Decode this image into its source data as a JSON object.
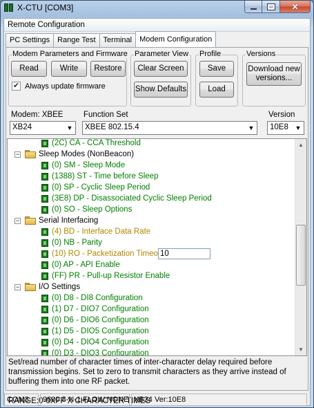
{
  "window": {
    "title": "X-CTU  [COM3]"
  },
  "header": {
    "title": "Remote Configuration"
  },
  "tabs": [
    {
      "label": "PC Settings"
    },
    {
      "label": "Range Test"
    },
    {
      "label": "Terminal"
    },
    {
      "label": "Modem Configuration",
      "active": true
    }
  ],
  "groups": {
    "modem_params": {
      "legend": "Modem Parameters and Firmware",
      "read": "Read",
      "write": "Write",
      "restore": "Restore",
      "always_update": "Always update firmware",
      "always_update_checked": true
    },
    "param_view": {
      "legend": "Parameter View",
      "clear": "Clear Screen",
      "show_defaults": "Show Defaults"
    },
    "profile": {
      "legend": "Profile",
      "save": "Save",
      "load": "Load"
    },
    "versions": {
      "legend": "Versions",
      "download_line1": "Download new",
      "download_line2": "versions..."
    }
  },
  "selectors": {
    "modem_label": "Modem: XBEE",
    "modem_value": "XB24",
    "function_label": "Function Set",
    "function_value": "XBEE 802.15.4",
    "version_label": "Version",
    "version_value": "10E8"
  },
  "tree": {
    "rows": [
      {
        "kind": "param",
        "text": "(2C) CA - CCA Threshold",
        "color": "green"
      },
      {
        "kind": "folder",
        "text": "Sleep Modes (NonBeacon)"
      },
      {
        "kind": "param",
        "text": "(0) SM - Sleep Mode",
        "color": "green"
      },
      {
        "kind": "param",
        "text": "(1388) ST - Time before Sleep",
        "color": "green"
      },
      {
        "kind": "param",
        "text": "(0) SP - Cyclic Sleep Period",
        "color": "green"
      },
      {
        "kind": "param",
        "text": "(3E8) DP - Disassociated Cyclic Sleep Period",
        "color": "green"
      },
      {
        "kind": "param",
        "text": "(0) SO - Sleep Options",
        "color": "green"
      },
      {
        "kind": "folder",
        "text": "Serial Interfacing"
      },
      {
        "kind": "param",
        "text": "(4) BD - Interface Data Rate",
        "color": "orange"
      },
      {
        "kind": "param",
        "text": "(0) NB - Parity",
        "color": "green"
      },
      {
        "kind": "param",
        "text": "(10) RO - Packetization Timeout",
        "color": "orange",
        "edit_value": "10"
      },
      {
        "kind": "param",
        "text": "(0) AP - API Enable",
        "color": "green"
      },
      {
        "kind": "param",
        "text": "(FF) PR - Pull-up Resistor Enable",
        "color": "green"
      },
      {
        "kind": "folder",
        "text": "I/O Settings"
      },
      {
        "kind": "param",
        "text": "(0) D8 - DI8 Configuration",
        "color": "green"
      },
      {
        "kind": "param",
        "text": "(1) D7 - DIO7 Configuration",
        "color": "green"
      },
      {
        "kind": "param",
        "text": "(0) D6 - DIO6 Configuration",
        "color": "green"
      },
      {
        "kind": "param",
        "text": "(1) D5 - DIO5 Configuration",
        "color": "green"
      },
      {
        "kind": "param",
        "text": "(0) D4 - DIO4 Configuration",
        "color": "green"
      },
      {
        "kind": "param",
        "text": "(0) D3 - DIO3 Configuration",
        "color": "green"
      }
    ]
  },
  "description": "Set/read number of character times of inter-character delay required before transmission begins. Set to zero to transmit characters as they arrive instead of buffering them into one RF packet.",
  "range": "RANGE:0-0XFF  X CHARACTER TIMES",
  "statusbar": {
    "port": "COM3",
    "settings": "9600 8-N-1  FLOW:NONE",
    "modem": "XB24  Ver:10E8"
  },
  "colors": {
    "green": "#008000",
    "orange": "#b28600"
  }
}
